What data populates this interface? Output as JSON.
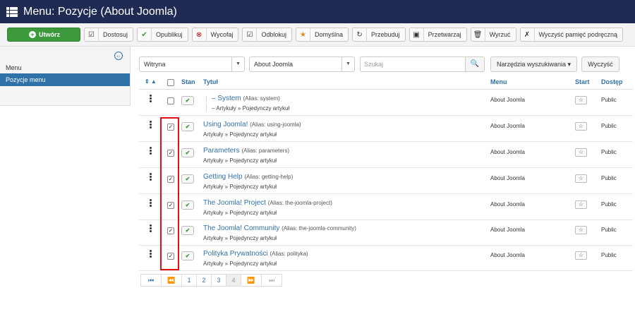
{
  "header": {
    "title": "Menu: Pozycje (About Joomla)"
  },
  "toolbar": {
    "create": "Utwórz",
    "buttons": [
      {
        "label": "Dostosuj",
        "icon": "edit-icon"
      },
      {
        "label": "Opublikuj",
        "icon": "check-icon"
      },
      {
        "label": "Wycofaj",
        "icon": "unpublish-icon"
      },
      {
        "label": "Odblokuj",
        "icon": "checkin-icon"
      },
      {
        "label": "Domyślna",
        "icon": "star-icon"
      },
      {
        "label": "Przebuduj",
        "icon": "refresh-icon"
      },
      {
        "label": "Przetwarzaj",
        "icon": "batch-icon"
      },
      {
        "label": "Wyrzuć",
        "icon": "trash-icon"
      },
      {
        "label": "Wyczyść pamięć podręczną",
        "icon": "broom-icon"
      }
    ]
  },
  "sidebar": {
    "heading": "Menu",
    "active_item": "Pozycje menu"
  },
  "filters": {
    "client": "Witryna",
    "menu": "About Joomla",
    "search_placeholder": "Szukaj",
    "tools": "Narzędzia wyszukiwania ▾",
    "clear": "Wyczyść"
  },
  "table": {
    "headers": {
      "state": "Stan",
      "title": "Tytuł",
      "menu": "Menu",
      "home": "Start",
      "access": "Dostęp"
    },
    "rows": [
      {
        "title": "System",
        "alias": "(Alias: system)",
        "sub": "Artykuły » Pojedynczy artykuł",
        "menu": "About Joomla",
        "access": "Public",
        "checked": "",
        "tree_prefix": "–"
      },
      {
        "title": "Using Joomla!",
        "alias": "(Alias: using-joomla)",
        "sub": "Artykuły » Pojedynczy artykuł",
        "menu": "About Joomla",
        "access": "Public",
        "checked": "✓"
      },
      {
        "title": "Parameters",
        "alias": "(Alias: parameters)",
        "sub": "Artykuły » Pojedynczy artykuł",
        "menu": "About Joomla",
        "access": "Public",
        "checked": "✓"
      },
      {
        "title": "Getting Help",
        "alias": "(Alias: getting-help)",
        "sub": "Artykuły » Pojedynczy artykuł",
        "menu": "About Joomla",
        "access": "Public",
        "checked": "✓"
      },
      {
        "title": "The Joomla! Project",
        "alias": "(Alias: the-joomla-project)",
        "sub": "Artykuły » Pojedynczy artykuł",
        "menu": "About Joomla",
        "access": "Public",
        "checked": "✓"
      },
      {
        "title": "The Joomla! Community",
        "alias": "(Alias: the-joomla-community)",
        "sub": "Artykuły » Pojedynczy artykuł",
        "menu": "About Joomla",
        "access": "Public",
        "checked": "✓"
      },
      {
        "title": "Polityka Prywatności",
        "alias": "(Alias: polityka)",
        "sub": "Artykuły » Pojedynczy artykuł",
        "menu": "About Joomla",
        "access": "Public",
        "checked": "✓"
      }
    ]
  },
  "pagination": {
    "pages": [
      "1",
      "2",
      "3",
      "4"
    ],
    "current": "4"
  },
  "colors": {
    "header": "#1f2b52",
    "accent": "#3071a9",
    "create": "#3c9a3c",
    "highlight": "#e01010"
  }
}
